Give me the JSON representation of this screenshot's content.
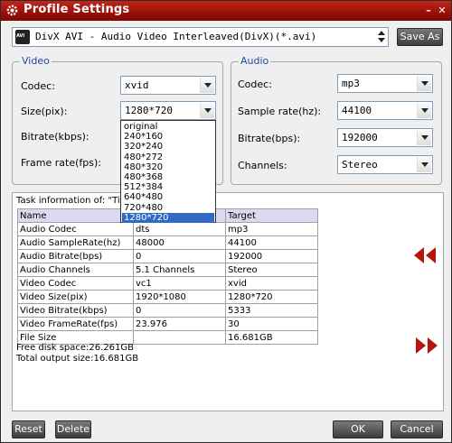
{
  "window": {
    "title": "Profile Settings",
    "minimize_glyph": "–",
    "close_glyph": "✕",
    "app_icon": "gear-icon"
  },
  "profile": {
    "selected": "DivX AVI - Audio Video Interleaved(DivX)(*.avi)",
    "icon_text": "AVI",
    "save_as_label": "Save As"
  },
  "video": {
    "group_title": "Video",
    "codec_label": "Codec:",
    "codec_value": "xvid",
    "size_label": "Size(pix):",
    "size_value": "1280*720",
    "bitrate_label": "Bitrate(kbps):",
    "framerate_label": "Frame rate(fps):"
  },
  "audio": {
    "group_title": "Audio",
    "codec_label": "Codec:",
    "codec_value": "mp3",
    "samplerate_label": "Sample rate(hz):",
    "samplerate_value": "44100",
    "bitrate_label": "Bitrate(bps):",
    "bitrate_value": "192000",
    "channels_label": "Channels:",
    "channels_value": "Stereo"
  },
  "size_dropdown": {
    "options": [
      "original",
      "240*160",
      "320*240",
      "480*272",
      "480*320",
      "480*368",
      "512*384",
      "640*480",
      "720*480",
      "1280*720"
    ],
    "selected_index": 9
  },
  "task": {
    "title": "Task information of: \"Ti",
    "headers": [
      "Name",
      "",
      "Target"
    ],
    "rows": [
      [
        "Audio Codec",
        "dts",
        "mp3"
      ],
      [
        "Audio SampleRate(hz)",
        "48000",
        "44100"
      ],
      [
        "Audio Bitrate(bps)",
        "0",
        "192000"
      ],
      [
        "Audio Channels",
        "5.1 Channels",
        "Stereo"
      ],
      [
        "Video Codec",
        "vc1",
        "xvid"
      ],
      [
        "Video Size(pix)",
        "1920*1080",
        "1280*720"
      ],
      [
        "Video Bitrate(kbps)",
        "0",
        "5333"
      ],
      [
        "Video FrameRate(fps)",
        "23.976",
        "30"
      ],
      [
        "File Size",
        "",
        "16.681GB"
      ]
    ],
    "free_disk": "Free disk space:26.261GB",
    "total_output": "Total output size:16.681GB"
  },
  "footer": {
    "reset_label": "Reset",
    "delete_label": "Delete",
    "ok_label": "OK",
    "cancel_label": "Cancel"
  },
  "colors": {
    "titlebar": "#9a0f07",
    "group_title": "#2246a8",
    "nav_arrow": "#b4150c",
    "selection": "#316ac5"
  }
}
